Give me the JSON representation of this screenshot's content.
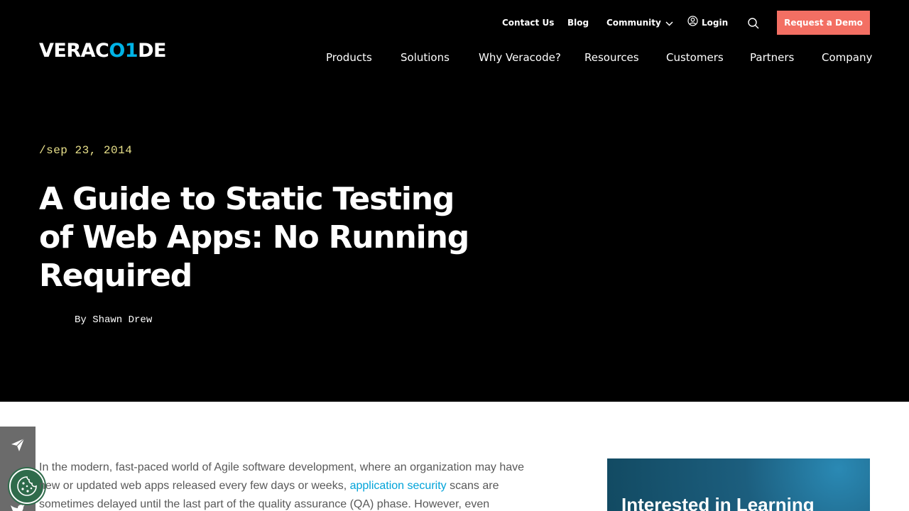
{
  "brand": {
    "logo_text_a": "VERAC",
    "logo_text_b": "O1",
    "logo_text_c": "DE"
  },
  "utility_nav": {
    "contact": "Contact Us",
    "blog": "Blog",
    "community": "Community",
    "login": "Login",
    "demo_button": "Request a Demo"
  },
  "main_nav": [
    "Products",
    "Solutions",
    "Why Veracode?",
    "Resources",
    "Customers",
    "Partners",
    "Company"
  ],
  "post": {
    "date": "/sep 23, 2014",
    "title": "A Guide to Static Testing of Web Apps: No Running Required",
    "author": "By Shawn Drew"
  },
  "article": {
    "intro_part1": "In the modern, fast-paced world of Agile software development, where an organization may have new or updated web apps released every few days or weeks, ",
    "intro_link": "application security",
    "intro_part2": " scans are sometimes delayed until the last part of the quality assurance (QA) phase. However, even"
  },
  "cta": {
    "heading": "Interested in Learning"
  },
  "colors": {
    "hero_bg": "#000000",
    "accent_logo": "#00b3e6",
    "demo_button": "#f36f63",
    "date": "#e8e08a",
    "link": "#00a3d9",
    "cookie": "#2f6b4b"
  },
  "icons": {
    "search": "search-icon",
    "login": "user-circle-icon",
    "community": "chevron-down-icon",
    "share": "paper-plane-icon",
    "cookie": "cookie-icon"
  }
}
